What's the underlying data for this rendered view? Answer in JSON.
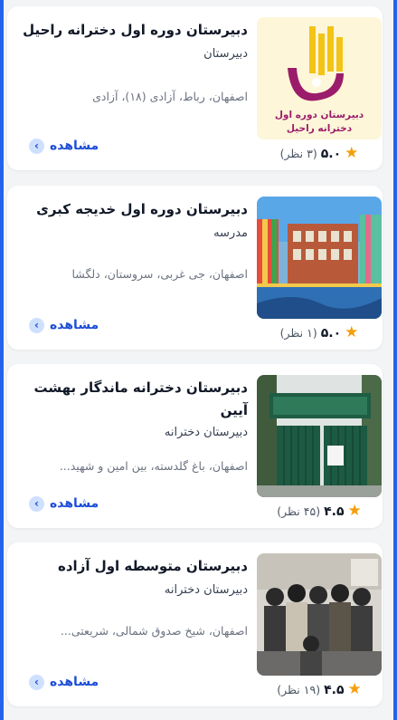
{
  "ui": {
    "view_label": "مشاهده",
    "view_chevron": "‹"
  },
  "schools": [
    {
      "title": "دبیرستان دوره اول دخترانه راحیل",
      "type": "دبیرستان",
      "address": "اصفهان، رباط، آزادی (۱۸)، آزادی",
      "rating": "۵.۰",
      "reviews": "(۳ نظر)",
      "image": "logo-raheel",
      "logo_text_1": "دبیرستان دوره اول",
      "logo_text_2": "دخترانه راحیل",
      "logo_accent": "#f3c316"
    },
    {
      "title": "دبیرستان دوره اول خدیجه کبری",
      "type": "مدرسه",
      "address": "اصفهان، جی غربی، سروستان، دلگشا",
      "rating": "۵.۰",
      "reviews": "(۱ نظر)",
      "image": "building-photo"
    },
    {
      "title": "دبیرستان دخترانه ماندگار بهشت آیین",
      "type": "دبیرستان دخترانه",
      "address": "اصفهان، باغ گلدسته، بین امین و شهید...",
      "rating": "۴.۵",
      "reviews": "(۴۵ نظر)",
      "image": "gate-photo"
    },
    {
      "title": "دبیرستان متوسطه اول آزاده",
      "type": "دبیرستان دخترانه",
      "address": "اصفهان، شیخ صدوق شمالی، شریعتی...",
      "rating": "۴.۵",
      "reviews": "(۱۹ نظر)",
      "image": "students-photo"
    }
  ],
  "colors": {
    "accent": "#1d4ed8",
    "star": "#f59e0b",
    "chevron_bg": "#cfe0ff"
  }
}
